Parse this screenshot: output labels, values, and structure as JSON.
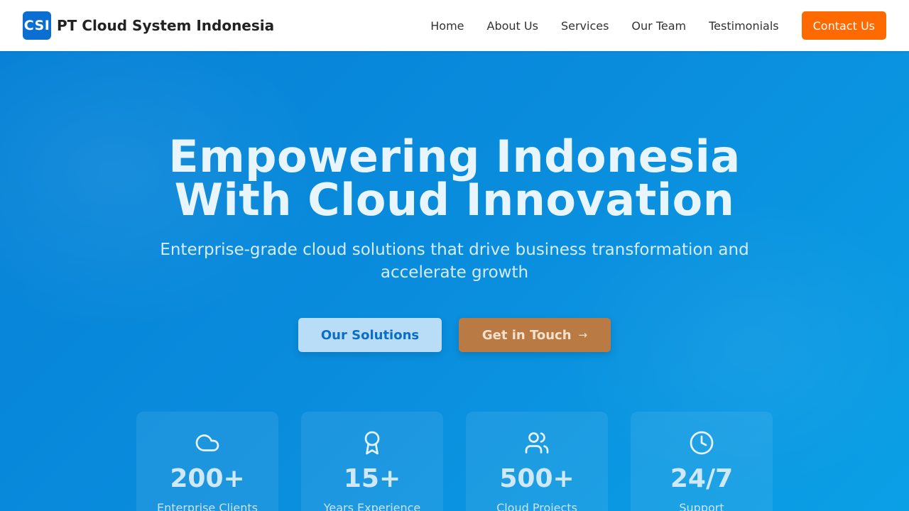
{
  "nav": {
    "logo_text": "CSI",
    "brand": "PT Cloud System Indonesia",
    "links": [
      "Home",
      "About Us",
      "Services",
      "Our Team",
      "Testimonials"
    ],
    "cta": "Contact Us"
  },
  "hero": {
    "headline_line1": "Empowering Indonesia",
    "headline_line2": "With Cloud Innovation",
    "subline": "Enterprise-grade cloud solutions that drive business transformation and accelerate growth",
    "primary_button": "Our Solutions",
    "secondary_button": "Get in Touch",
    "secondary_icon": "arrow-right-icon"
  },
  "stats": [
    {
      "icon": "cloud-icon",
      "value": "200+",
      "label": "Enterprise Clients"
    },
    {
      "icon": "award-icon",
      "value": "15+",
      "label": "Years Experience"
    },
    {
      "icon": "users-icon",
      "value": "500+",
      "label": "Cloud Projects"
    },
    {
      "icon": "clock-icon",
      "value": "24/7",
      "label": "Support"
    }
  ],
  "colors": {
    "nav_bg": "#ffffff",
    "accent_orange": "#ff6a00",
    "brand_blue": "#0a6fd1",
    "hero_blue": "#0a8ad9"
  }
}
